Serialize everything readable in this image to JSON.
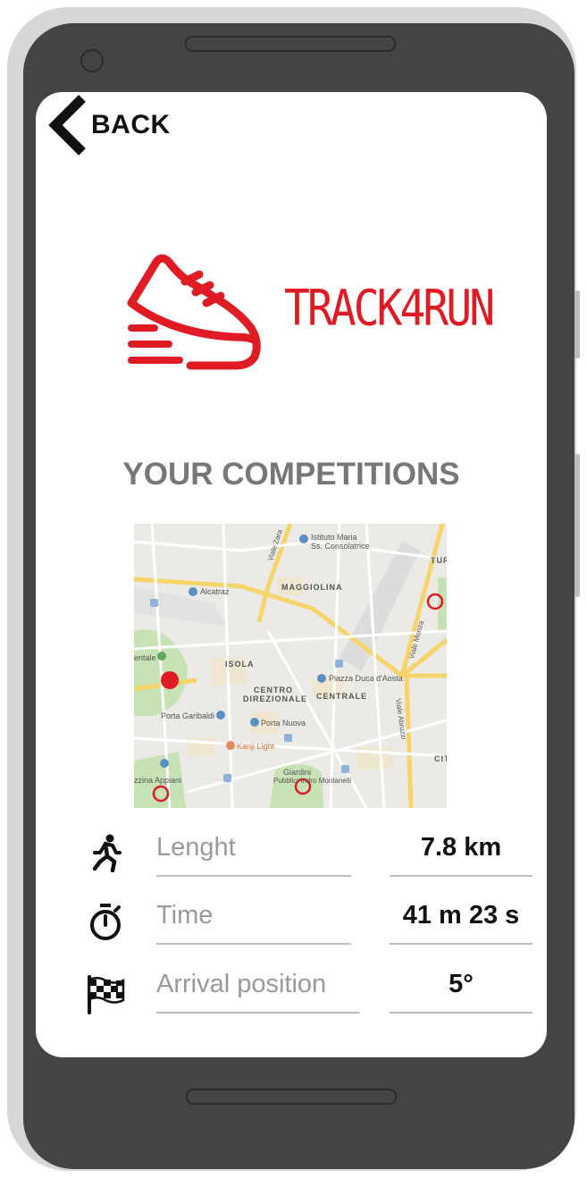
{
  "header": {
    "back_label": "BACK"
  },
  "brand": {
    "name": "TRACK4RUN",
    "color": "#e01b24"
  },
  "section": {
    "title": "YOUR COMPETITIONS"
  },
  "map": {
    "labels": {
      "istituto": "Istituto Maria",
      "istituto2": "Ss. Consolatrice",
      "alcatraz": "Alcatraz",
      "maggiolina": "MAGGIOLINA",
      "isola": "ISOLA",
      "centro": "CENTRO",
      "direzionale": "DIREZIONALE",
      "centrale": "CENTRALE",
      "piazza": "Piazza Duca d'Aosta",
      "porta_garibaldi": "Porta Garibaldi",
      "porta_nuova": "Porta Nuova",
      "kanji": "Kanji Light",
      "giardini": "Giardini",
      "montanelli": "Pubblici Indro Montanelli",
      "appiani": "zzina Appiani",
      "centrale_park": "entale",
      "turi": "TURI",
      "citta": "CIT",
      "viale_zara": "Viale Zara",
      "viale_abruzzi": "Viale Abruzzi",
      "viale_monza": "Viale Monza"
    }
  },
  "stats": [
    {
      "icon": "runner-icon",
      "label": "Lenght",
      "value": "7.8 km"
    },
    {
      "icon": "stopwatch-icon",
      "label": "Time",
      "value": "41 m 23 s"
    },
    {
      "icon": "checkered-flag-icon",
      "label": "Arrival position",
      "value": "5°"
    }
  ]
}
